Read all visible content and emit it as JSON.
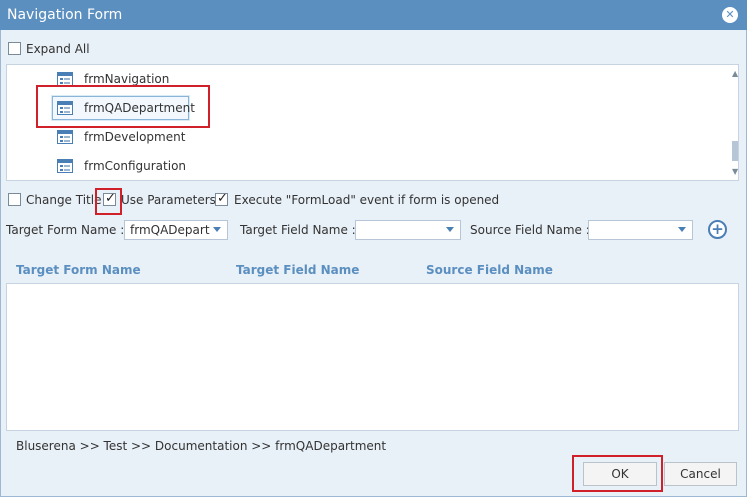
{
  "window": {
    "title": "Navigation Form"
  },
  "expand_all": {
    "label": "Expand All",
    "checked": false
  },
  "tree": {
    "items": [
      {
        "label": "frmNavigation"
      },
      {
        "label": "frmQADepartment",
        "selected": true
      },
      {
        "label": "frmDevelopment"
      },
      {
        "label": "frmConfiguration"
      }
    ]
  },
  "options": {
    "change_title": {
      "label": "Change Title",
      "checked": false
    },
    "use_parameters": {
      "label": "Use Parameters",
      "checked": true
    },
    "execute_formload": {
      "label": "Execute \"FormLoad\" event if form is opened",
      "checked": true
    }
  },
  "mapping": {
    "target_form_label": "Target Form Name :",
    "target_form_value": "frmQADepart",
    "target_field_label": "Target Field Name :",
    "target_field_value": "",
    "source_field_label": "Source Field Name :",
    "source_field_value": "",
    "add_icon": "plus-circle-icon"
  },
  "grid": {
    "columns": [
      "Target Form Name",
      "Target Field Name",
      "Source Field Name"
    ],
    "rows": []
  },
  "breadcrumb": "Bluserena >> Test >> Documentation >> frmQADepartment",
  "buttons": {
    "ok": "OK",
    "cancel": "Cancel"
  },
  "colors": {
    "title_bar": "#5b8fc0",
    "highlight": "#d0202a",
    "column_header": "#5b8fc0"
  }
}
